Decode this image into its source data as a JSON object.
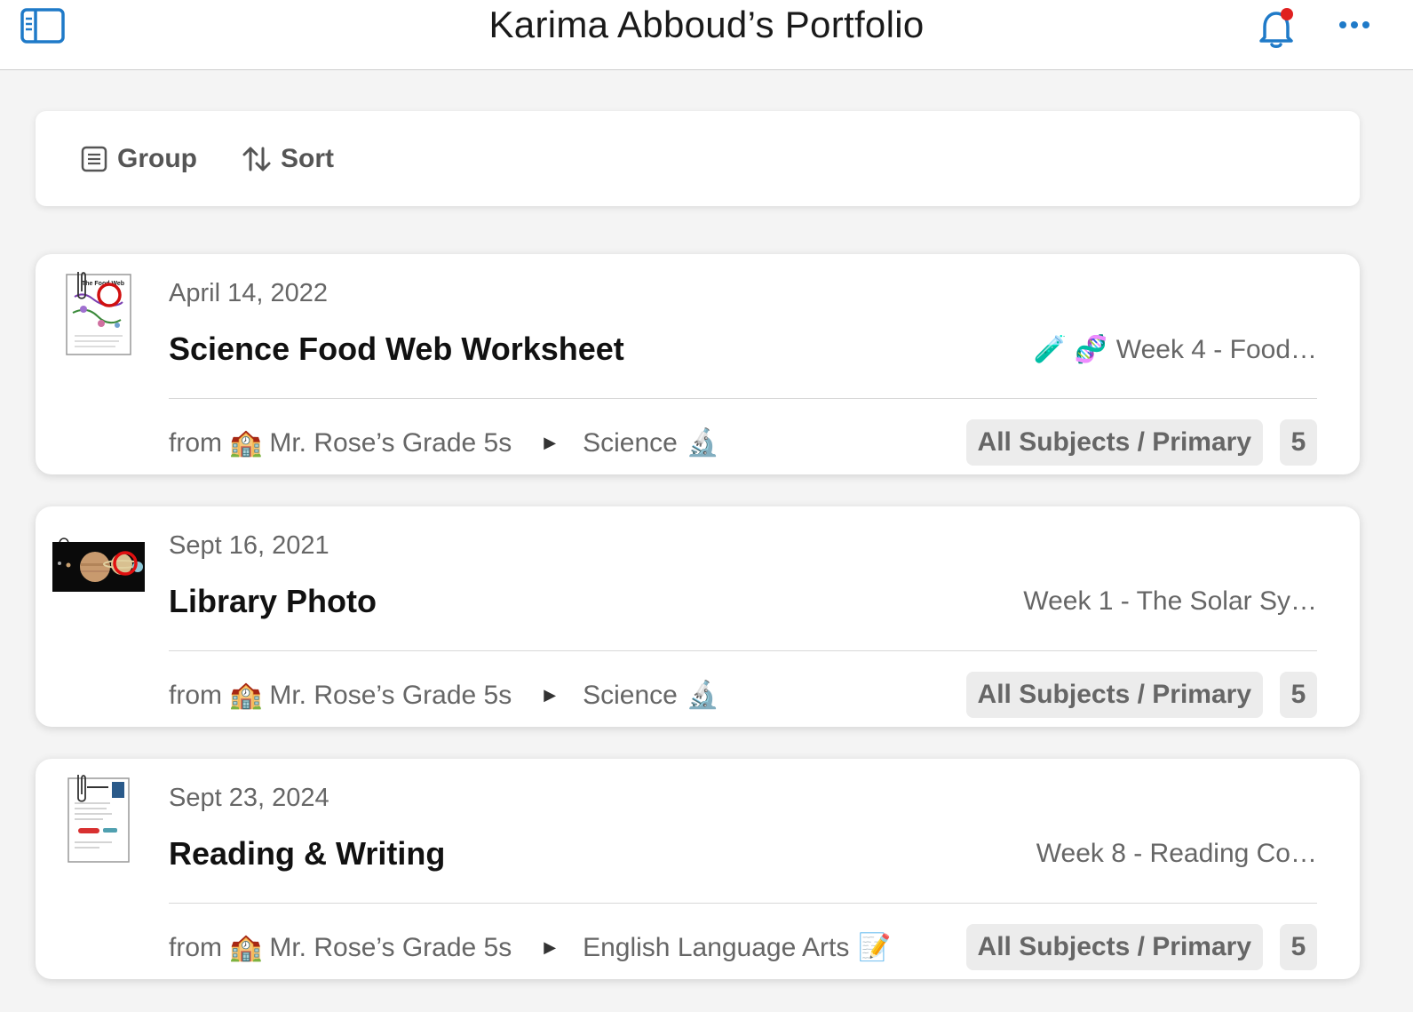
{
  "header": {
    "title": "Karima Abboud’s Portfolio",
    "accent_color": "#1f7ac8",
    "badge_color": "#e02020"
  },
  "toolbar": {
    "group_label": "Group",
    "sort_label": "Sort"
  },
  "cards": [
    {
      "date": "April 14, 2022",
      "title": "Science Food Web Worksheet",
      "week_emojis": "🧪 🧬",
      "week": "Week 4 - Food…",
      "from_label": "from",
      "school_emoji": "🏫",
      "class_name": "Mr. Rose’s Grade 5s",
      "subject": "Science",
      "subject_emoji": "🔬",
      "tag": "All Subjects / Primary",
      "count": "5",
      "thumbnail": "worksheet-thumbnail"
    },
    {
      "date": "Sept 16, 2021",
      "title": "Library Photo",
      "week_emojis": "",
      "week": "Week 1 - The Solar Sy…",
      "from_label": "from",
      "school_emoji": "🏫",
      "class_name": "Mr. Rose’s Grade 5s",
      "subject": "Science",
      "subject_emoji": "🔬",
      "tag": "All Subjects / Primary",
      "count": "5",
      "thumbnail": "solar-system-photo-thumbnail"
    },
    {
      "date": "Sept 23, 2024",
      "title": "Reading & Writing",
      "week_emojis": "",
      "week": "Week 8 - Reading Co…",
      "from_label": "from",
      "school_emoji": "🏫",
      "class_name": "Mr. Rose’s Grade 5s",
      "subject": "English Language Arts",
      "subject_emoji": "📝",
      "tag": "All Subjects / Primary",
      "count": "5",
      "thumbnail": "reading-document-thumbnail"
    }
  ]
}
